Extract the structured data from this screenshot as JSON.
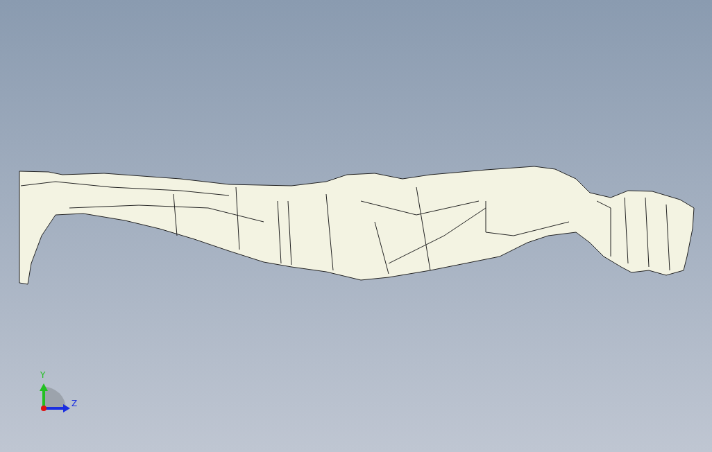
{
  "viewport": {
    "model": {
      "kind": "figure"
    },
    "triad": {
      "axes": [
        {
          "label": "Y",
          "color": "#22c022"
        },
        {
          "label": "Z",
          "color": "#1a2ee0"
        }
      ]
    }
  }
}
